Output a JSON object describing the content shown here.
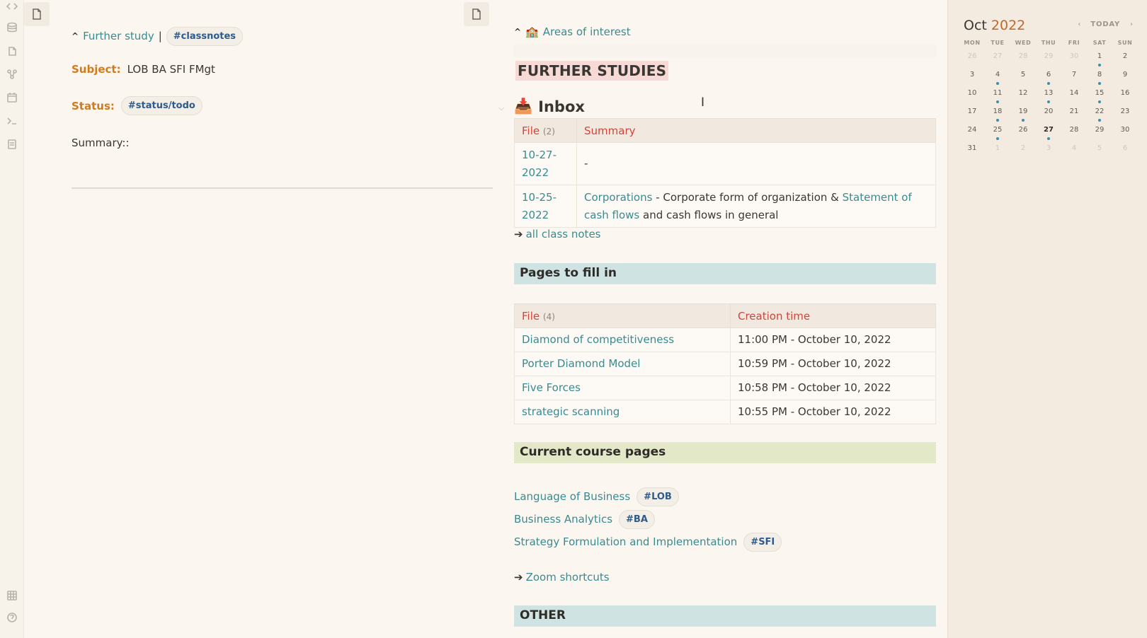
{
  "colors": {
    "accent_link": "#3a8a8f",
    "tag_text": "#2e5a8c",
    "property_key": "#d17b1e",
    "table_header": "#d0453a",
    "band_blue": "#cfe3e3",
    "band_green": "#e2e8c8",
    "further_highlight": "#f7d9d5",
    "calendar_dot": "#3e8fa8",
    "year_text": "#c2682a"
  },
  "ribbon": {
    "icons": [
      "code-icon",
      "database-icon",
      "files-icon",
      "graph-icon",
      "calendar-icon",
      "terminal-icon",
      "template-icon",
      "vault-icon",
      "help-icon"
    ]
  },
  "left": {
    "breadcrumb": {
      "caret": "^",
      "link": "Further study",
      "sep": "|",
      "tag": "#classnotes"
    },
    "subject": {
      "key": "Subject:",
      "value": "LOB BA SFI FMgt"
    },
    "status": {
      "key": "Status:",
      "tag": "#status/todo"
    },
    "summary": "Summary::"
  },
  "right": {
    "areas": {
      "caret": "^",
      "emoji": "🏫",
      "link": "Areas of interest"
    },
    "title": "FURTHER STUDIES",
    "inbox": {
      "emoji": "📥",
      "heading": "Inbox",
      "columns": {
        "file": "File",
        "file_count": "(2)",
        "summary": "Summary"
      },
      "rows": [
        {
          "file_a": "10-27-",
          "file_b": "2022",
          "summary_plain": "-"
        },
        {
          "file_a": "10-25-",
          "file_b": "2022",
          "link1": "Corporations",
          "text1": " - Corporate form of organization & ",
          "link2a": "Statement of",
          "link2b": "cash flows",
          "text2": " and cash flows in general"
        }
      ],
      "all_notes_arrow": "➔",
      "all_notes": "all class notes"
    },
    "pages_to_fill": {
      "heading": "Pages to fill in",
      "columns": {
        "file": "File",
        "file_count": "(4)",
        "created": "Creation time"
      },
      "rows": [
        {
          "file": "Diamond of competitiveness",
          "created": "11:00 PM - October 10, 2022"
        },
        {
          "file": "Porter Diamond Model",
          "created": "10:59 PM - October 10, 2022"
        },
        {
          "file": "Five Forces",
          "created": "10:58 PM - October 10, 2022"
        },
        {
          "file": "strategic scanning",
          "created": "10:55 PM - October 10, 2022"
        }
      ]
    },
    "current_course": {
      "heading": "Current course pages",
      "items": [
        {
          "link": "Language of Business",
          "tag": "#LOB"
        },
        {
          "link": "Business Analytics",
          "tag": "#BA"
        },
        {
          "link": "Strategy Formulation and Implementation",
          "tag": "#SFI"
        }
      ]
    },
    "zoom": {
      "arrow": "➔",
      "label": "Zoom shortcuts"
    },
    "other": {
      "heading": "OTHER"
    }
  },
  "calendar": {
    "month": "Oct",
    "year": "2022",
    "today_label": "TODAY",
    "prev": "‹",
    "next": "›",
    "dows": [
      "MON",
      "TUE",
      "WED",
      "THU",
      "FRI",
      "SAT",
      "SUN"
    ],
    "weeks": [
      [
        {
          "d": "26",
          "m": 1
        },
        {
          "d": "27",
          "m": 1
        },
        {
          "d": "28",
          "m": 1
        },
        {
          "d": "29",
          "m": 1
        },
        {
          "d": "30",
          "m": 1
        },
        {
          "d": "1",
          "dot": 1
        },
        {
          "d": "2"
        }
      ],
      [
        {
          "d": "3"
        },
        {
          "d": "4",
          "dot": 1
        },
        {
          "d": "5"
        },
        {
          "d": "6",
          "dot": 1
        },
        {
          "d": "7"
        },
        {
          "d": "8",
          "dot": 1
        },
        {
          "d": "9"
        }
      ],
      [
        {
          "d": "10"
        },
        {
          "d": "11",
          "dot": 1
        },
        {
          "d": "12"
        },
        {
          "d": "13",
          "dot": 1
        },
        {
          "d": "14"
        },
        {
          "d": "15",
          "dot": 1
        },
        {
          "d": "16"
        }
      ],
      [
        {
          "d": "17"
        },
        {
          "d": "18",
          "dot": 1
        },
        {
          "d": "19",
          "dot": 1
        },
        {
          "d": "20"
        },
        {
          "d": "21"
        },
        {
          "d": "22",
          "dot": 1
        },
        {
          "d": "23"
        }
      ],
      [
        {
          "d": "24"
        },
        {
          "d": "25",
          "dot": 1
        },
        {
          "d": "26"
        },
        {
          "d": "27",
          "t": 1,
          "dot": 1
        },
        {
          "d": "28"
        },
        {
          "d": "29"
        },
        {
          "d": "30"
        }
      ],
      [
        {
          "d": "31"
        },
        {
          "d": "1",
          "m": 1
        },
        {
          "d": "2",
          "m": 1
        },
        {
          "d": "3",
          "m": 1
        },
        {
          "d": "4",
          "m": 1
        },
        {
          "d": "5",
          "m": 1
        },
        {
          "d": "6",
          "m": 1
        }
      ]
    ]
  }
}
